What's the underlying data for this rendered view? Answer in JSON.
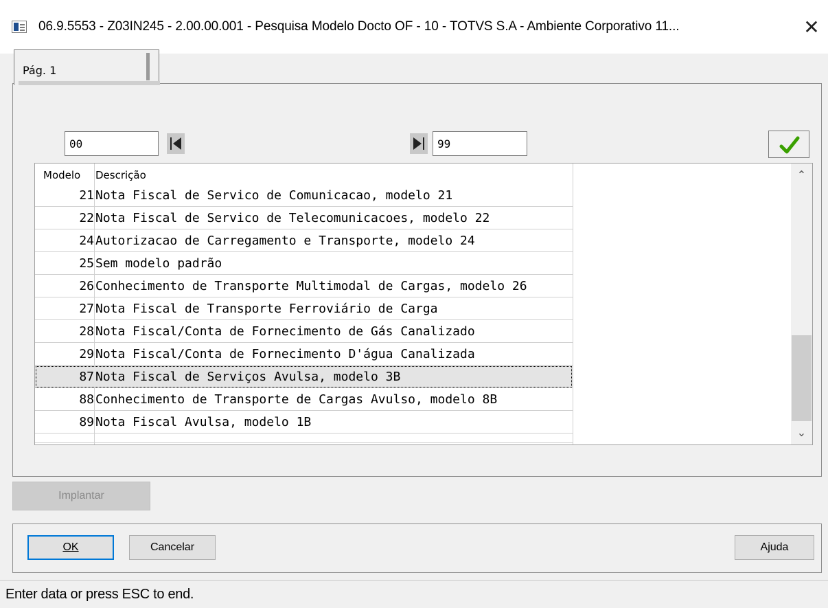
{
  "window": {
    "title": "06.9.5553 - Z03IN245 - 2.00.00.001 - Pesquisa Modelo Docto OF - 10 - TOTVS S.A - Ambiente Corporativo 11...",
    "close_symbol": "✕"
  },
  "tabs": [
    {
      "label": "Pág. 1",
      "active": true
    }
  ],
  "range": {
    "from_value": "00",
    "to_value": "99"
  },
  "grid": {
    "columns": [
      "Modelo",
      "Descrição"
    ],
    "rows": [
      {
        "modelo": "21",
        "descricao": "Nota Fiscal de Servico de Comunicacao, modelo 21"
      },
      {
        "modelo": "22",
        "descricao": "Nota Fiscal de Servico de Telecomunicacoes, modelo 22"
      },
      {
        "modelo": "24",
        "descricao": "Autorizacao de Carregamento e Transporte, modelo 24"
      },
      {
        "modelo": "25",
        "descricao": "Sem modelo padrão"
      },
      {
        "modelo": "26",
        "descricao": "Conhecimento de Transporte Multimodal de Cargas, modelo 26"
      },
      {
        "modelo": "27",
        "descricao": "Nota Fiscal de Transporte Ferroviário de Carga"
      },
      {
        "modelo": "28",
        "descricao": "Nota Fiscal/Conta de Fornecimento de Gás Canalizado"
      },
      {
        "modelo": "29",
        "descricao": "Nota Fiscal/Conta de Fornecimento D'água Canalizada"
      },
      {
        "modelo": "87",
        "descricao": "Nota Fiscal de Serviços Avulsa, modelo 3B"
      },
      {
        "modelo": "88",
        "descricao": "Conhecimento de Transporte de Cargas Avulso, modelo 8B"
      },
      {
        "modelo": "89",
        "descricao": "Nota Fiscal Avulsa, modelo 1B"
      },
      {
        "modelo": "",
        "descricao": ""
      }
    ],
    "selected_row": 8
  },
  "buttons": {
    "implantar": "Implantar",
    "ok": "OK",
    "cancelar": "Cancelar",
    "ajuda": "Ajuda"
  },
  "status": {
    "text": "Enter data or press ESC to end."
  },
  "colors": {
    "accent": "#0078d7",
    "check_green": "#3aa000",
    "selected_row": "#e4e4e4",
    "window_bg": "#f0f0f0"
  },
  "icons": {
    "first": "first-record-icon",
    "last": "last-record-icon",
    "confirm": "checkmark-icon",
    "scroll_up": "chevron-up-icon",
    "scroll_down": "chevron-down-icon"
  }
}
